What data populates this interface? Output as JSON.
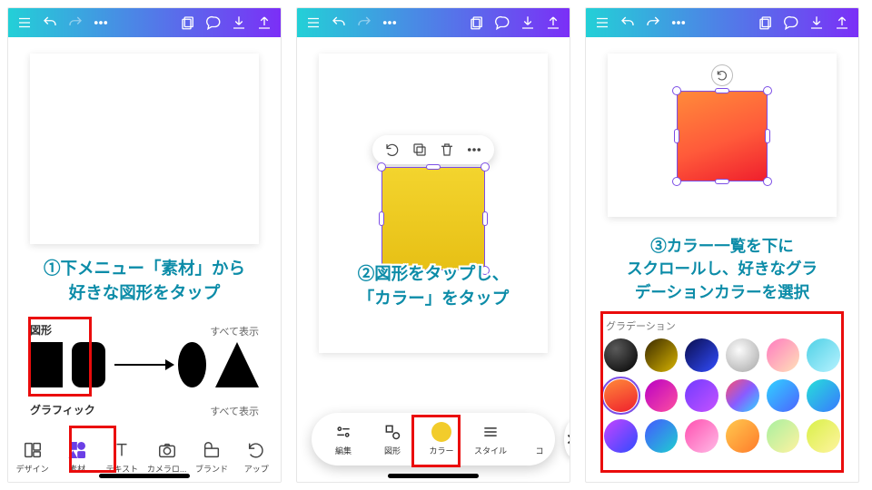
{
  "toolbar_icons": [
    "menu",
    "undo",
    "redo",
    "more",
    "layers",
    "comment",
    "download",
    "share"
  ],
  "panel1": {
    "instruction": "①下メニュー「素材」から\n好きな図形をタップ",
    "section_shapes": "図形",
    "section_graphics": "グラフィック",
    "view_all": "すべて表示",
    "tabs": [
      {
        "id": "design",
        "label": "デザイン"
      },
      {
        "id": "elements",
        "label": "素材",
        "selected": true
      },
      {
        "id": "text",
        "label": "テキスト"
      },
      {
        "id": "camera",
        "label": "カメラロ..."
      },
      {
        "id": "brand",
        "label": "ブランド"
      },
      {
        "id": "apps",
        "label": "アップ"
      }
    ]
  },
  "panel2": {
    "instruction": "②図形をタップし、\n「カラー」をタップ",
    "float_tools": [
      "rotate",
      "duplicate",
      "delete",
      "more"
    ],
    "tabs": [
      {
        "id": "edit",
        "label": "編集"
      },
      {
        "id": "shapes",
        "label": "図形"
      },
      {
        "id": "color",
        "label": "カラー",
        "selected": true
      },
      {
        "id": "style",
        "label": "スタイル"
      },
      {
        "id": "copy",
        "label": "コ"
      }
    ]
  },
  "panel3": {
    "instruction": "③カラー一覧を下に\nスクロールし、好きなグラ\nデーションカラーを選択",
    "palette_title": "グラデーション",
    "swatches": [
      {
        "css": "radial-gradient(circle at 35% 30%,#5a5a5a,#000)"
      },
      {
        "css": "linear-gradient(135deg,#3a2a00,#d8b400)"
      },
      {
        "css": "linear-gradient(135deg,#0a0d4d,#324dff)"
      },
      {
        "css": "radial-gradient(circle at 40% 35%,#fbfbfb,#a5a5a5)"
      },
      {
        "css": "linear-gradient(135deg,#ff7bc0,#ffe2b8)"
      },
      {
        "css": "linear-gradient(135deg,#4fd1e6,#b7f2ff)"
      },
      {
        "css": "linear-gradient(160deg,#ff8a3a,#ef1f2d)",
        "selected": true
      },
      {
        "css": "linear-gradient(135deg,#b800c4,#ff4fa0)"
      },
      {
        "css": "linear-gradient(135deg,#713bff,#c552ff)"
      },
      {
        "css": "linear-gradient(135deg,#ff4f6a,#8a5bff,#2fd7ff)"
      },
      {
        "css": "linear-gradient(135deg,#30d3ff,#4c63ff)"
      },
      {
        "css": "linear-gradient(135deg,#26e0d9,#3978ff)"
      },
      {
        "css": "linear-gradient(135deg,#c644ff,#2f4bff)"
      },
      {
        "css": "linear-gradient(135deg,#4558ff,#1ecfd0)"
      },
      {
        "css": "linear-gradient(135deg,#ff4fb0,#ffbbe6)"
      },
      {
        "css": "linear-gradient(135deg,#ffc94f,#ff7b2a)"
      },
      {
        "css": "linear-gradient(135deg,#a8f0a0,#fff2a0)"
      },
      {
        "css": "linear-gradient(135deg,#d9f048,#fff4a0)"
      }
    ]
  }
}
